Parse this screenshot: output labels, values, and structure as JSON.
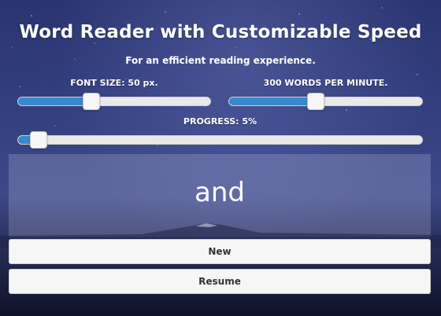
{
  "header": {
    "title": "Word Reader with Customizable Speed",
    "subtitle": "For an efficient reading experience."
  },
  "controls": {
    "font_size": {
      "label": "FONT SIZE: 50 px.",
      "value_fraction": 0.38
    },
    "speed": {
      "label": "300 WORDS PER MINUTE.",
      "value_fraction": 0.45
    },
    "progress": {
      "label": "PROGRESS: 5%",
      "value_fraction": 0.05
    }
  },
  "reader": {
    "current_word": "and"
  },
  "buttons": {
    "new_label": "New",
    "resume_label": "Resume"
  },
  "colors": {
    "slider_fill": "#3a88cc",
    "button_bg": "#f6f6f6",
    "text": "#ffffff"
  }
}
